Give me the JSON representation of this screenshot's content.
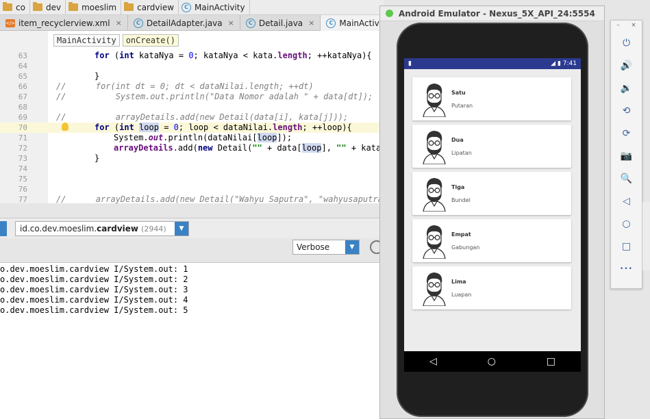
{
  "breadcrumbs": [
    {
      "label": "co",
      "icon": "folder-icon"
    },
    {
      "label": "dev",
      "icon": "folder-icon"
    },
    {
      "label": "moeslim",
      "icon": "folder-icon"
    },
    {
      "label": "cardview",
      "icon": "folder-icon"
    },
    {
      "label": "MainActivity",
      "icon": "class-icon"
    }
  ],
  "tabs": [
    {
      "label": "item_recyclerview.xml",
      "icon": "xml-file-icon",
      "close": "×"
    },
    {
      "label": "DetailAdapter.java",
      "icon": "class-icon",
      "close": "×"
    },
    {
      "label": "Detail.java",
      "icon": "class-icon",
      "close": "×"
    },
    {
      "label": "MainActivity.java",
      "icon": "class-icon",
      "close": "×",
      "active": true
    }
  ],
  "editor": {
    "method_bar": [
      "MainActivity",
      "onCreate()"
    ],
    "lines": [
      {
        "num": "63",
        "code": "for (int kataNya = 0; kataNya < kata.length; ++kataNya){"
      },
      {
        "num": "64",
        "code": ""
      },
      {
        "num": "65",
        "code": "}"
      },
      {
        "num": "66",
        "code": "//      for(int dt = 0; dt < dataNilai.length; ++dt)"
      },
      {
        "num": "67",
        "code": "//          System.out.println(\"Data Nomor adalah \" + data[dt]);"
      },
      {
        "num": "68",
        "code": ""
      },
      {
        "num": "69",
        "code": "//          arrayDetails.add(new Detail(data[i], kata[j]));"
      },
      {
        "num": "70",
        "code": "for (int loop = 0; loop < dataNilai.length; ++loop){"
      },
      {
        "num": "71",
        "code": "    System.out.println(dataNilai[loop]);"
      },
      {
        "num": "72",
        "code": "    arrayDetails.add(new Detail(\"\" + data[loop], \"\" + kata[l"
      },
      {
        "num": "73",
        "code": "}"
      },
      {
        "num": "74",
        "code": ""
      },
      {
        "num": "75",
        "code": ""
      },
      {
        "num": "76",
        "code": ""
      },
      {
        "num": "77",
        "code": "//      arrayDetails.add(new Detail(\"Wahyu Saputra\", \"wahyusaputra"
      }
    ]
  },
  "logcat": {
    "process_prefix": "id.co.dev.moeslim.",
    "process_bold": "cardview",
    "pid": "(2944)",
    "level": "Verbose",
    "lines": [
      "o.dev.moeslim.cardview I/System.out: 1",
      "o.dev.moeslim.cardview I/System.out: 2",
      "o.dev.moeslim.cardview I/System.out: 3",
      "o.dev.moeslim.cardview I/System.out: 4",
      "o.dev.moeslim.cardview I/System.out: 5"
    ]
  },
  "emulator": {
    "title": "Android Emulator - Nexus_5X_API_24:5554",
    "status_time": "7:41",
    "cards": [
      {
        "name": "Satu",
        "sub": "Putaran"
      },
      {
        "name": "Dua",
        "sub": "Lipatan"
      },
      {
        "name": "Tiga",
        "sub": "Bundel"
      },
      {
        "name": "Empat",
        "sub": "Gabungan"
      },
      {
        "name": "Lima",
        "sub": "Luapan"
      }
    ],
    "nav": {
      "back": "◁",
      "home": "○",
      "recents": "□"
    }
  },
  "side_panel": {
    "window_controls": [
      "–",
      "×"
    ],
    "buttons": [
      {
        "name": "power-icon",
        "glyph": "⏻"
      },
      {
        "name": "volume-up-icon",
        "glyph": "🔊"
      },
      {
        "name": "volume-down-icon",
        "glyph": "🔉"
      },
      {
        "name": "rotate-left-icon",
        "glyph": "⟲"
      },
      {
        "name": "rotate-right-icon",
        "glyph": "⟳"
      },
      {
        "name": "camera-icon",
        "glyph": "📷"
      },
      {
        "name": "zoom-icon",
        "glyph": "🔍"
      },
      {
        "name": "back-icon",
        "glyph": "◁"
      },
      {
        "name": "home-icon",
        "glyph": "○"
      },
      {
        "name": "overview-icon",
        "glyph": "□"
      },
      {
        "name": "more-icon",
        "glyph": "•••"
      }
    ]
  },
  "colors": {
    "accent": "#3b82c4",
    "status_bar": "#2b3a8f",
    "current_line": "#fbf8d9"
  }
}
